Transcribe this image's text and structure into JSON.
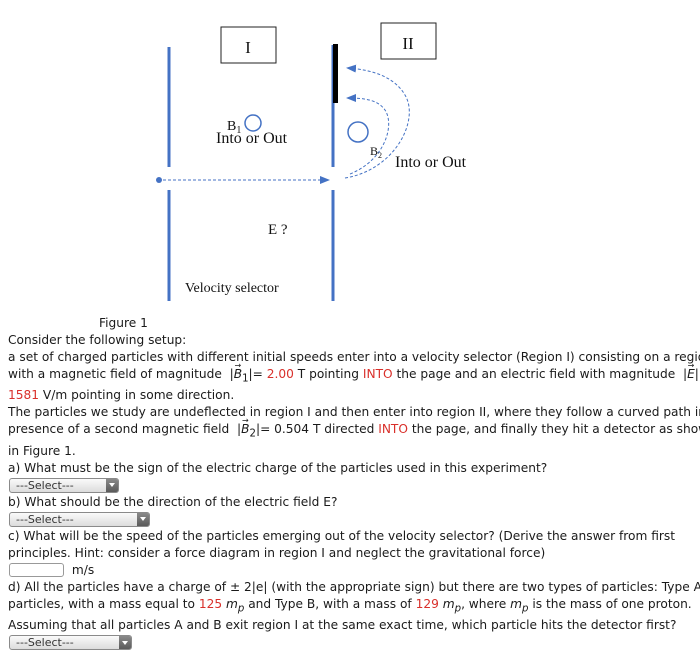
{
  "figure": {
    "region_labels": [
      "I",
      "II"
    ],
    "b1_label": "B",
    "b1_subscript": "1",
    "b1_direction": "Into or Out",
    "b2_label": "B",
    "b2_subscript": "2",
    "b2_direction": "Into or Out",
    "e_label": "E ?",
    "selector_label": "Velocity selector",
    "colors": {
      "plate": "#4472c4",
      "detector": "#000000",
      "path": "#4472c4"
    }
  },
  "text": {
    "caption": "Figure 1",
    "intro": "Consider the following setup:",
    "p1_a": "a set of charged particles with different initial speeds enter into a velocity selector (Region I) consisting on a region",
    "p1_b": "with a magnetic field of magnitude",
    "b1_symbol": "B",
    "b1_sub": "1",
    "b1_value": "2.00",
    "b1_unit": "T pointing",
    "b1_dir": "INTO",
    "p1_c": "the page and an electric field with magnitude",
    "e_symbol": "E",
    "e_value": "1581",
    "p1_d": "V/m pointing in some direction.",
    "p2_a": "The particles we study are undeflected in region I and then enter into region II, where they follow a curved path in the",
    "p2_b": "presence of a second magnetic field",
    "b2_symbol": "B",
    "b2_sub": "2",
    "b2_value": "0.504",
    "b2_unit": "T directed",
    "b2_dir": "INTO",
    "p2_c": "the page, and finally they hit a detector as shown",
    "p2_d": "in Figure 1.",
    "qa": "a) What must be the sign of the electric charge of the particles used in this experiment?",
    "qb": "b) What should be the direction of the electric field E?",
    "qc_a": "c) What will be the speed of the particles emerging out of the velocity selector? (Derive the answer from first",
    "qc_b": "principles. Hint: consider a force diagram in region I and neglect the gravitational force)",
    "qc_unit": "m/s",
    "qc_value": "",
    "qd_a": "d) All the particles have a charge of  ± 2|e|  (with the appropriate sign) but there are two types of particles: Type A",
    "qd_b1": "particles, with a mass equal to",
    "mass_a": "125",
    "mp": "m",
    "mp_sub": "p",
    "qd_b2": "and Type B, with a mass of",
    "mass_b": "129",
    "qd_b3": ", where",
    "qd_b4": "is the mass of one proton.",
    "qd_c": "Assuming that all particles A and B exit region I at the same exact time, which particle hits the detector first?"
  },
  "selects": {
    "a": "---Select---",
    "b": "---Select---",
    "d": "---Select---"
  }
}
